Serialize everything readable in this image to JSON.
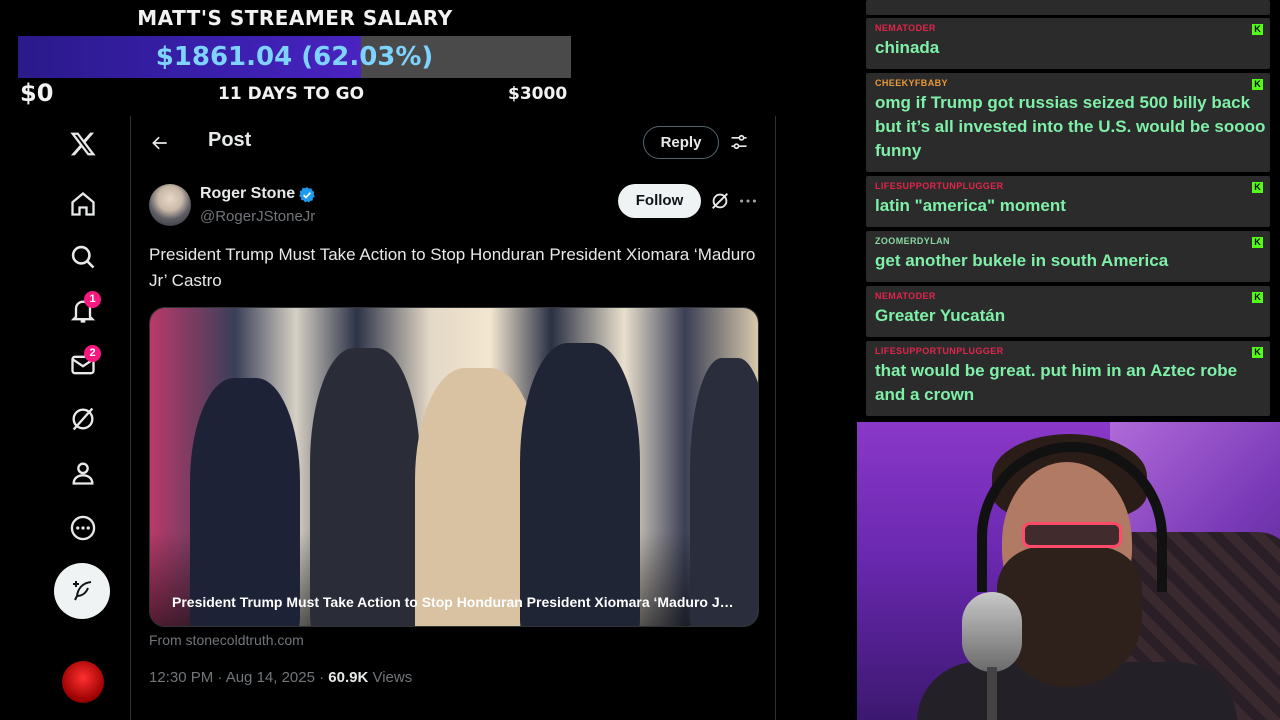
{
  "salary": {
    "title": "MATT'S STREAMER SALARY",
    "amount": "$1861.04 (62.03%)",
    "progress_fraction": 0.6203,
    "min": "$0",
    "days": "11 DAYS TO GO",
    "max": "$3000"
  },
  "x_nav": {
    "notifications_badge": "1",
    "messages_badge": "2"
  },
  "post": {
    "header_title": "Post",
    "reply_label": "Reply",
    "author_name": "Roger Stone",
    "author_handle": "@RogerJStoneJr",
    "follow_label": "Follow",
    "text": "President Trump Must Take Action to Stop Honduran President Xiomara ‘Maduro Jr’ Castro",
    "card_caption": "President Trump Must Take Action to Stop Honduran President Xiomara ‘Maduro Jr’ Castro",
    "card_source": "From stonecoldtruth.com",
    "time": "12:30 PM · Aug 14, 2025 · ",
    "views_count": "60.9K",
    "views_label": " Views"
  },
  "chat": [
    {
      "user": "NEMATODER",
      "user_color": "#e0264b",
      "text": "chinada"
    },
    {
      "user": "CHEEKYFBABY",
      "user_color": "#e89a3a",
      "text": "omg if Trump got russias seized 500 billy back but it’s all invested into the U.S. would be soooo funny"
    },
    {
      "user": "LIFESUPPORTUNPLUGGER",
      "user_color": "#e0264b",
      "text": "latin \"america\" moment"
    },
    {
      "user": "ZOOMERDYLAN",
      "user_color": "#8ad8a0",
      "text": "get another bukele in south America"
    },
    {
      "user": "NEMATODER",
      "user_color": "#e0264b",
      "text": "Greater Yucatán"
    },
    {
      "user": "LIFESUPPORTUNPLUGGER",
      "user_color": "#e0264b",
      "text": "that would be great. put him in an Aztec robe and a crown"
    }
  ],
  "kick_badge": "K",
  "colors": {
    "chat_text": "#7ff0a8",
    "accent_blue": "#1d9bf0",
    "badge_pink": "#f91880",
    "kick_green": "#53fc18"
  }
}
